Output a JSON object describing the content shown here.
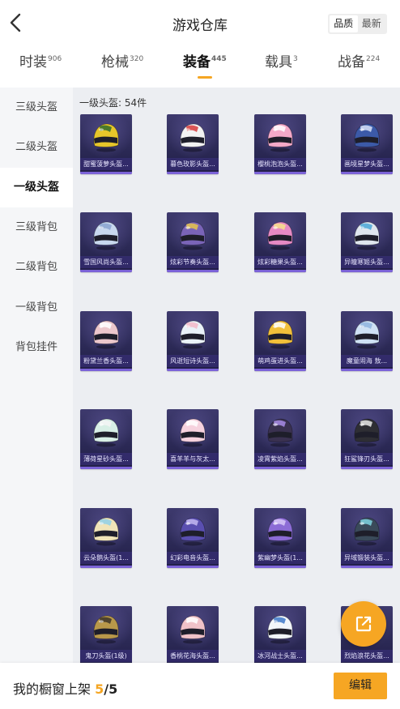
{
  "header": {
    "title": "游戏仓库",
    "sort_options": [
      "品质",
      "最新"
    ],
    "active_sort": 0
  },
  "tabs": [
    {
      "label": "时装",
      "count": "906"
    },
    {
      "label": "枪械",
      "count": "320"
    },
    {
      "label": "装备",
      "count": "445",
      "active": true
    },
    {
      "label": "载具",
      "count": "3"
    },
    {
      "label": "战备",
      "count": "224"
    }
  ],
  "sidebar": {
    "items": [
      {
        "label": "三级头盔"
      },
      {
        "label": "二级头盔"
      },
      {
        "label": "一级头盔",
        "active": true
      },
      {
        "label": "三级背包"
      },
      {
        "label": "二级背包"
      },
      {
        "label": "一级背包"
      },
      {
        "label": "背包挂件"
      }
    ]
  },
  "section": {
    "title": "一级头盔: 54件"
  },
  "items": [
    {
      "label": "甜蜜菠萝头盔...",
      "color": "#e7c62a",
      "accent": "#2f6b2a"
    },
    {
      "label": "暮色玫影头盔...",
      "color": "#f2f2f2",
      "accent": "#d63b3b"
    },
    {
      "label": "樱桃泡泡头盔...",
      "color": "#f4a9c8",
      "accent": "#ffffff"
    },
    {
      "label": "画境星梦头盔...",
      "color": "#3c5aa8",
      "accent": "#d8e2f8"
    },
    {
      "label": "雪国风尚头盔...",
      "color": "#c8d8ee",
      "accent": "#8aa4cf"
    },
    {
      "label": "炫彩节奏头盔...",
      "color": "#7a64b8",
      "accent": "#e7c44a"
    },
    {
      "label": "炫彩糖果头盔...",
      "color": "#e68ac4",
      "accent": "#f6e08a"
    },
    {
      "label": "异瞳寒姬头盔...",
      "color": "#dfe6ee",
      "accent": "#4aa6d6"
    },
    {
      "label": "粉黛兰香头盔...",
      "color": "#ecc7cc",
      "accent": "#ffffff"
    },
    {
      "label": "风逝短诗头盔...",
      "color": "#eaf2f8",
      "accent": "#f4b8c8"
    },
    {
      "label": "萌鸡蛋进头盔...",
      "color": "#f2c03a",
      "accent": "#ffffff"
    },
    {
      "label": "魔童闹海 敖...",
      "color": "#cfe1f4",
      "accent": "#8fb4de"
    },
    {
      "label": "薄荷星砂头盔...",
      "color": "#d8efe6",
      "accent": "#f4f4f4"
    },
    {
      "label": "喜羊羊与灰太...",
      "color": "#f6d2de",
      "accent": "#ffffff"
    },
    {
      "label": "凌霄紫焰头盔...",
      "color": "#3a3150",
      "accent": "#a98ce6"
    },
    {
      "label": "狂鲨锋刃头盔...",
      "color": "#2e2e34",
      "accent": "#e8e8e8"
    },
    {
      "label": "云朵鹅头盔(1...",
      "color": "#f0e4b8",
      "accent": "#8fd0e8"
    },
    {
      "label": "幻彩电音头盔...",
      "color": "#5a4fb0",
      "accent": "#c4b8f2"
    },
    {
      "label": "紫幽梦头盔(1...",
      "color": "#8c6cd6",
      "accent": "#d8c8f8"
    },
    {
      "label": "异域锻装头盔...",
      "color": "#3a4a5a",
      "accent": "#7fd4e0"
    },
    {
      "label": "鬼刀头盔(1级)",
      "color": "#b8984a",
      "accent": "#3c3428"
    },
    {
      "label": "香桃花海头盔...",
      "color": "#f0c2c8",
      "accent": "#ffffff"
    },
    {
      "label": "冰河战士头盔...",
      "color": "#f2f6fa",
      "accent": "#3e78c8"
    },
    {
      "label": "烈焰浪花头盔...",
      "color": "#eef2f4",
      "accent": "#5a8ed0"
    }
  ],
  "footer": {
    "shelf_text": "我的橱窗上架",
    "shelf_current": "5",
    "shelf_separator": "/",
    "shelf_total": "5",
    "edit_label": "编辑"
  },
  "icons": {
    "back": "chevron-left-icon",
    "share": "external-link-icon"
  },
  "colors": {
    "accent": "#f6a623",
    "sidebar_bg": "#f5f6f8",
    "content_bg": "#eceef2",
    "card_bg": "#2b2955"
  }
}
